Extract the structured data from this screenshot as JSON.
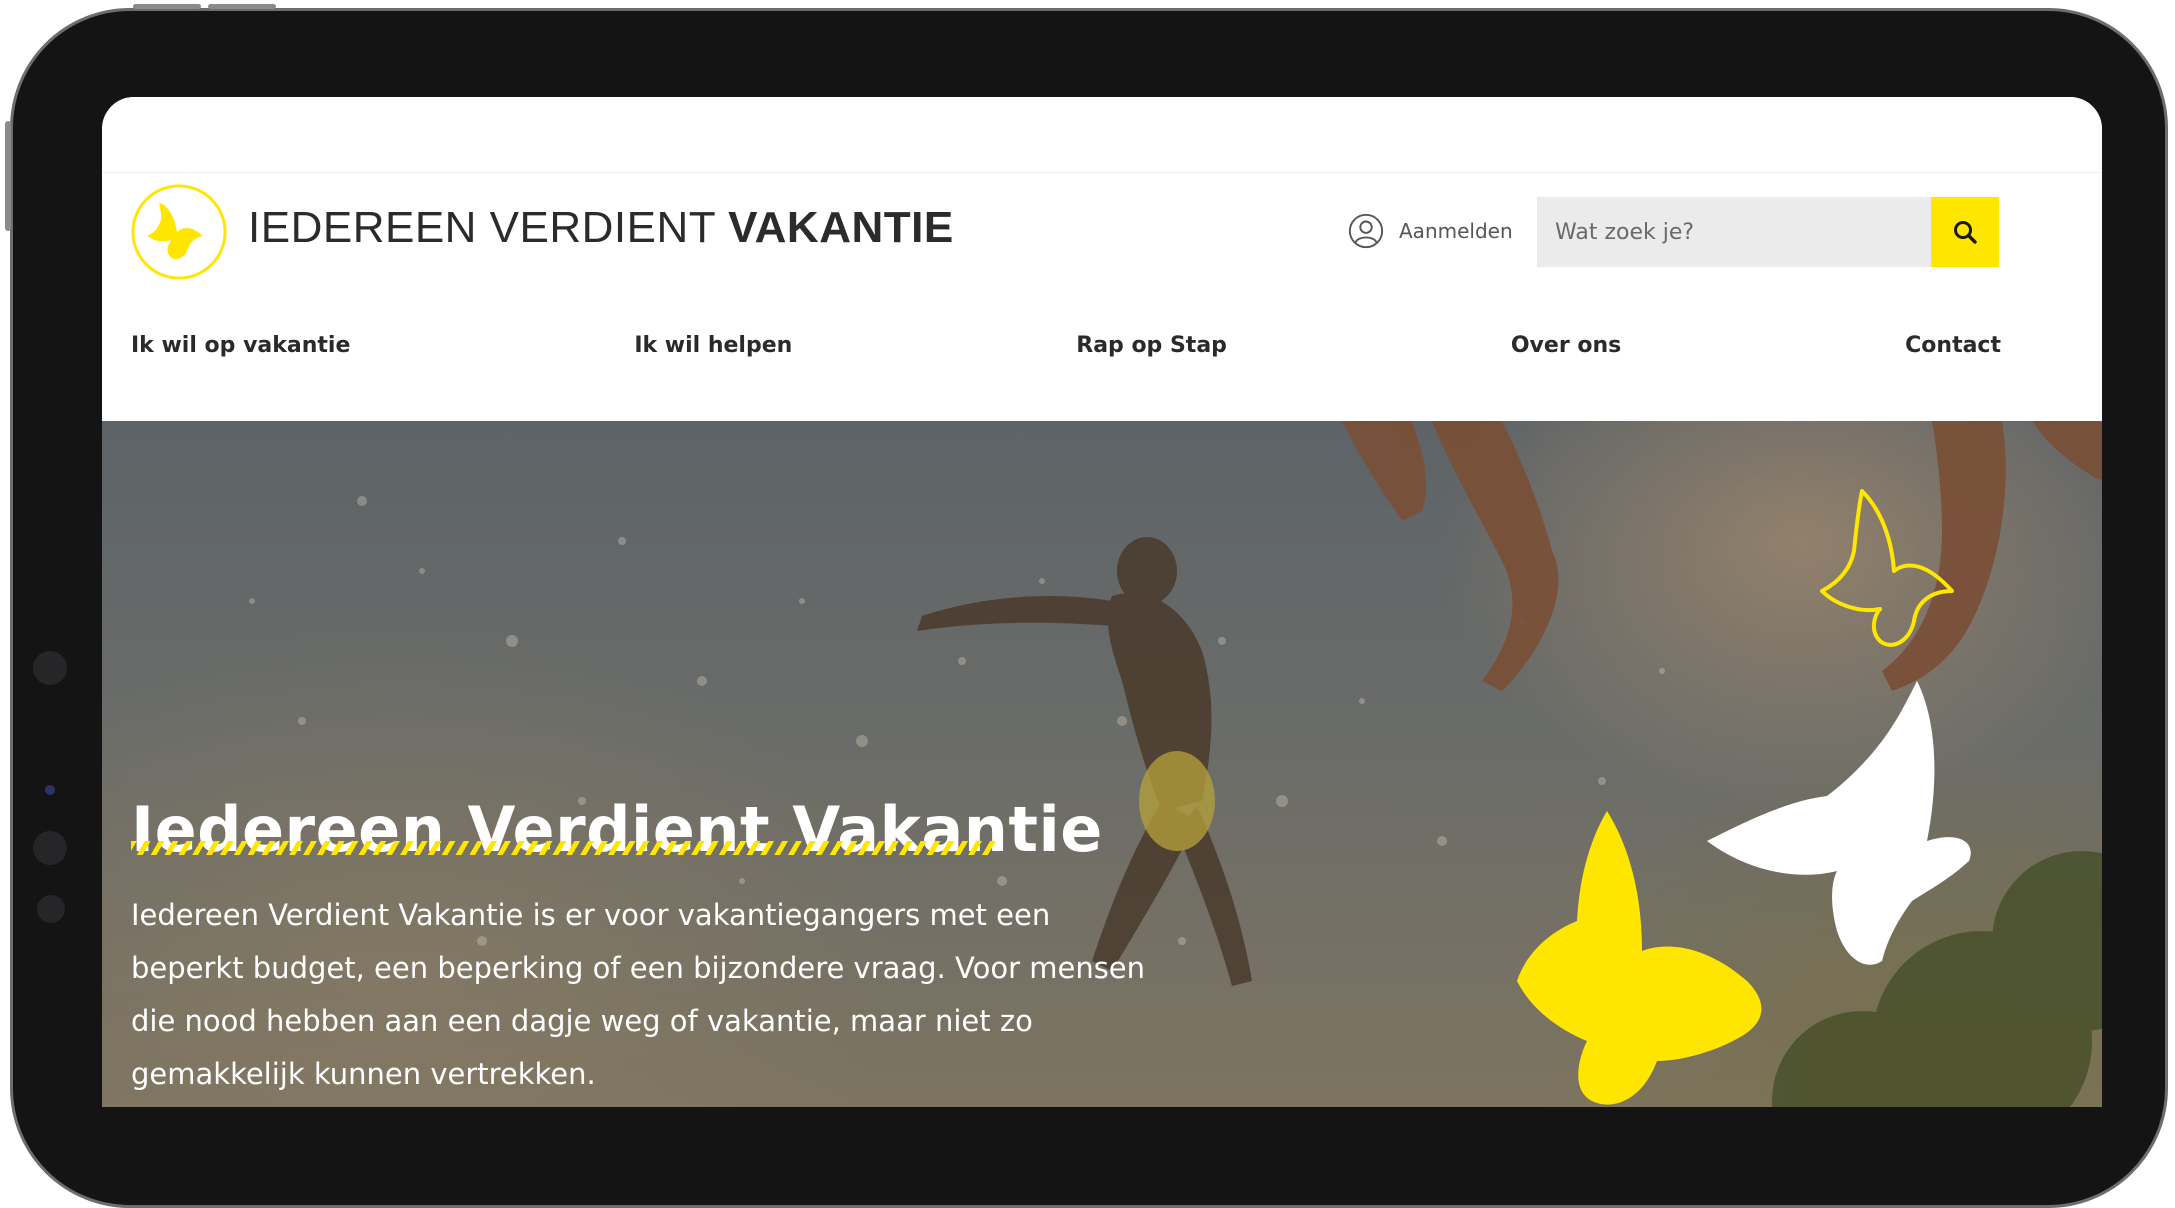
{
  "header": {
    "site_title_regular": "IEDEREEN VERDIENT ",
    "site_title_bold": "VAKANTIE",
    "login_label": "Aanmelden",
    "search_placeholder": "Wat zoek je?"
  },
  "nav": {
    "items": [
      {
        "label": "Ik wil op vakantie"
      },
      {
        "label": "Ik wil helpen"
      },
      {
        "label": "Rap op Stap"
      },
      {
        "label": "Over ons"
      },
      {
        "label": "Contact"
      }
    ]
  },
  "hero": {
    "title": "Iedereen Verdient Vakantie",
    "text": "Iedereen Verdient Vakantie is er voor vakantiegangers met een beperkt budget, een beperking of een bijzondere vraag. Voor mensen die nood hebben aan een dagje weg of vakantie, maar niet zo gemakkelijk kunnen vertrekken."
  },
  "colors": {
    "brand_yellow": "#ffe600",
    "text_dark": "#2b2b2b",
    "device_frame": "#141414"
  },
  "icons": [
    "butterfly-logo-icon",
    "user-circle-icon",
    "search-icon",
    "butterfly-icon"
  ]
}
